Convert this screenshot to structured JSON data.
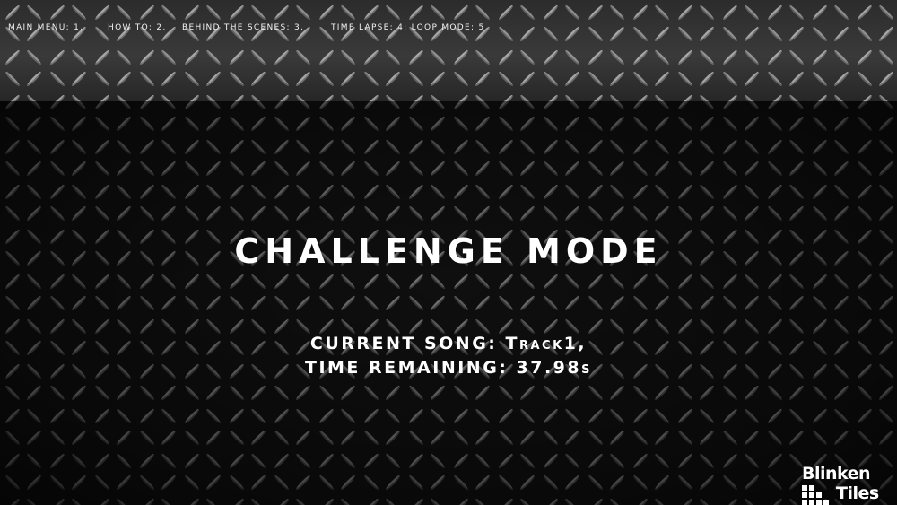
{
  "hotkeys": {
    "main_menu": "Main Menu: 1,",
    "how_to": "How To: 2,",
    "behind_scenes": "Behind the Scenes: 3,",
    "time_lapse_loop": "Time Lapse: 4; Loop Mode: 5"
  },
  "mode_title": "Challenge Mode",
  "status": {
    "current_song_label": "Current Song: ",
    "current_song_value": "Track1,",
    "time_remaining_label": "Time Remaining: ",
    "time_remaining_value": "37.98s"
  },
  "logo": {
    "line1": "Blinken",
    "line2": "Tiles"
  },
  "colors": {
    "text": "#ffffff",
    "plate_dark": "#0b0b0b",
    "plate_ridge": "#6e6e6e"
  },
  "icons": {
    "background": "diamond-plate-texture",
    "logo_mark": "tile-grid-icon"
  }
}
